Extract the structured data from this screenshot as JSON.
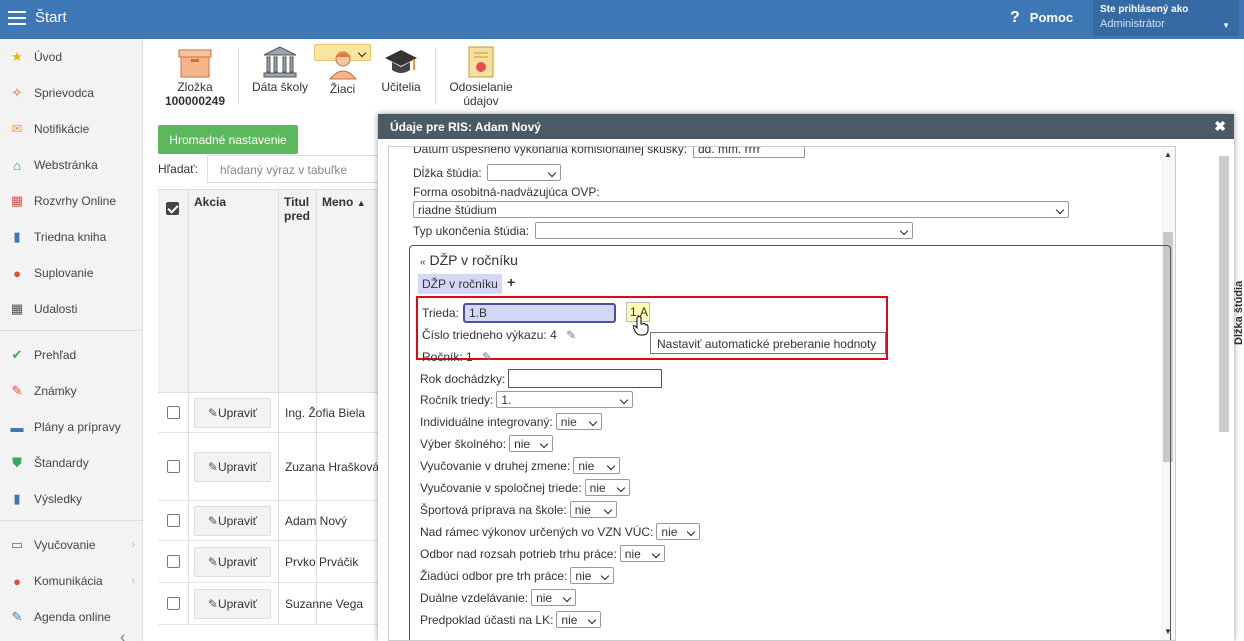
{
  "header": {
    "title": "Štart",
    "help_label": "Pomoc",
    "user_line1": "Ste prihlásený ako",
    "user_line2": "Administrátor"
  },
  "sidebar": {
    "items": [
      {
        "label": "Úvod",
        "icon": "star-icon",
        "color": "#f0b400"
      },
      {
        "label": "Sprievodca",
        "icon": "magic-wand-icon",
        "color": "#e54d2e"
      },
      {
        "label": "Notifikácie",
        "icon": "envelope-icon",
        "color": "#f0a030"
      },
      {
        "label": "Webstránka",
        "icon": "home-icon",
        "color": "#2e9b6e"
      },
      {
        "label": "Rozvrhy Online",
        "icon": "calendar-grid-icon",
        "color": "#d9534f"
      },
      {
        "label": "Triedna kniha",
        "icon": "book-icon",
        "color": "#3e77b5"
      },
      {
        "label": "Suplovanie",
        "icon": "user-icon",
        "color": "#e54d2e"
      },
      {
        "label": "Udalosti",
        "icon": "calendar-icon",
        "color": "#555555"
      },
      {
        "label": "Prehľad",
        "icon": "check-circle-icon",
        "color": "#3aaa55"
      },
      {
        "label": "Známky",
        "icon": "grades-icon",
        "color": "#e54d2e"
      },
      {
        "label": "Plány a prípravy",
        "icon": "briefcase-icon",
        "color": "#3e77b5"
      },
      {
        "label": "Štandardy",
        "icon": "shield-check-icon",
        "color": "#3aaa55"
      },
      {
        "label": "Výsledky",
        "icon": "bar-chart-icon",
        "color": "#3e77b5"
      },
      {
        "label": "Vyučovanie",
        "icon": "open-book-icon",
        "color": "#3e77b5"
      },
      {
        "label": "Komunikácia",
        "icon": "chat-icon",
        "color": "#e54d2e"
      },
      {
        "label": "Agenda online",
        "icon": "pen-icon",
        "color": "#3e77b5"
      }
    ]
  },
  "toolbar": {
    "zlozka_label": "Zložka",
    "zlozka_number": "100000249",
    "data_skoly": "Dáta školy",
    "ziaci": "Žiaci",
    "ucitelia": "Učitelia",
    "odosielanie": "Odosielanie",
    "udajov": "údajov"
  },
  "list": {
    "bulk_button": "Hromadné nastavenie",
    "search_label": "Hľadať:",
    "search_placeholder": "hľadaný výraz v tabuľke",
    "col_akcia": "Akcia",
    "col_titul1": "Titul",
    "col_titul2": "pred",
    "col_meno": "Meno",
    "edit_label": "Upraviť",
    "rows": [
      {
        "name": "Ing. Žofia Biela"
      },
      {
        "name": "Zuzana Hrašková"
      },
      {
        "name": "Adam Nový"
      },
      {
        "name": "Prvko Prváčik"
      },
      {
        "name": "Suzanne Vega"
      }
    ]
  },
  "modal": {
    "title": "Údaje pre RIS: Adam Nový",
    "cut_top_label": "Dátum úspešného vykonania komisionálnej skúšky:",
    "cut_top_value": "dd. mm. rrrr",
    "dlzka_studia_label": "Dĺžka štúdia:",
    "dlzka_studia_value": "",
    "forma_label": "Forma osobitná-nadväzujúca OVP:",
    "forma_value": "riadne štúdium",
    "typ_ukoncenia_label": "Typ ukončenia štúdia:",
    "typ_ukoncenia_value": "",
    "panel_title": "DŽP v ročníku",
    "panel_tab": "DŽP v ročníku",
    "trieda_label": "Trieda:",
    "trieda_value": "1.B",
    "trieda_badge": "1.A",
    "tooltip": "Nastaviť automatické preberanie hodnoty",
    "cislo_label": "Číslo triedneho výkazu:",
    "cislo_value": "4",
    "rocnik_label": "Ročník:",
    "rocnik_value": "1",
    "fields": [
      {
        "label": "Rok dochádzky:",
        "value": "",
        "type": "input"
      },
      {
        "label": "Ročník triedy:",
        "value": "1.",
        "type": "select"
      },
      {
        "label": "Individuálne integrovaný:",
        "value": "nie",
        "type": "select"
      },
      {
        "label": "Výber školného:",
        "value": "nie",
        "type": "select"
      },
      {
        "label": "Vyučovanie v druhej zmene:",
        "value": "nie",
        "type": "select"
      },
      {
        "label": "Vyučovanie v spoločnej triede:",
        "value": "nie",
        "type": "select"
      },
      {
        "label": "Športová príprava na škole:",
        "value": "nie",
        "type": "select"
      },
      {
        "label": "Nad rámec výkonov určených vo VZN VÚC:",
        "value": "nie",
        "type": "select"
      },
      {
        "label": "Odbor nad rozsah potrieb trhu práce:",
        "value": "nie",
        "type": "select"
      },
      {
        "label": "Žiadúci odbor pre trh práce:",
        "value": "nie",
        "type": "select"
      },
      {
        "label": "Duálne vzdelávanie:",
        "value": "nie",
        "type": "select"
      },
      {
        "label": "Predpoklad účasti na LK:",
        "value": "nie",
        "type": "select"
      }
    ]
  },
  "right_edge": {
    "vertical_label": "Dĺžka štúdia"
  }
}
